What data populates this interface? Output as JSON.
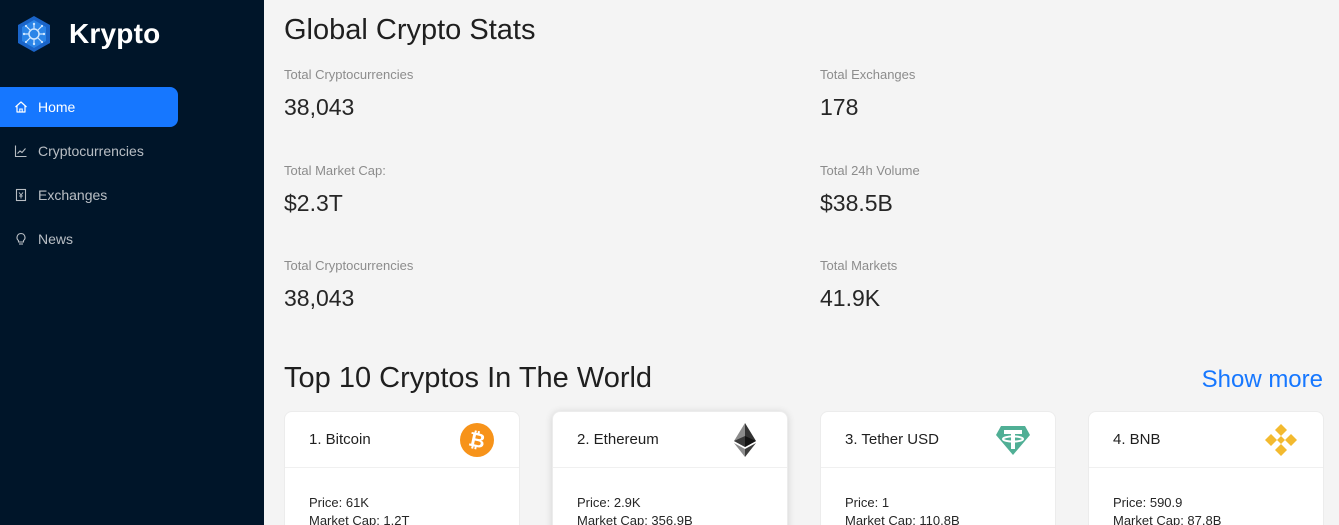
{
  "brand": {
    "name": "Krypto",
    "logo_icon": "hexagon-chip-logo"
  },
  "menu": [
    {
      "label": "Home",
      "icon": "home-icon",
      "active": true
    },
    {
      "label": "Cryptocurrencies",
      "icon": "line-chart-icon",
      "active": false
    },
    {
      "label": "Exchanges",
      "icon": "money-collect-icon",
      "active": false
    },
    {
      "label": "News",
      "icon": "bulb-icon",
      "active": false
    }
  ],
  "global_stats": {
    "title": "Global Crypto Stats",
    "items": [
      {
        "label": "Total Cryptocurrencies",
        "value": "38,043"
      },
      {
        "label": "Total Exchanges",
        "value": "178"
      },
      {
        "label": "Total Market Cap:",
        "value": "$2.3T"
      },
      {
        "label": "Total 24h Volume",
        "value": "$38.5B"
      },
      {
        "label": "Total Cryptocurrencies",
        "value": "38,043"
      },
      {
        "label": "Total Markets",
        "value": "41.9K"
      }
    ]
  },
  "top_cryptos": {
    "title": "Top 10 Cryptos In The World",
    "show_more": "Show more",
    "cards": [
      {
        "title": "1. Bitcoin",
        "icon": "bitcoin-icon",
        "price": "Price: 61K",
        "market_cap": "Market Cap: 1.2T"
      },
      {
        "title": "2. Ethereum",
        "icon": "ethereum-icon",
        "price": "Price: 2.9K",
        "market_cap": "Market Cap: 356.9B"
      },
      {
        "title": "3. Tether USD",
        "icon": "tether-icon",
        "price": "Price: 1",
        "market_cap": "Market Cap: 110.8B"
      },
      {
        "title": "4. BNB",
        "icon": "bnb-icon",
        "price": "Price: 590.9",
        "market_cap": "Market Cap: 87.8B"
      }
    ]
  },
  "colors": {
    "sidebar": "#001529",
    "accent": "#1677ff",
    "bitcoin": "#f7931a",
    "tether": "#50af95",
    "bnb": "#f3ba2f"
  }
}
